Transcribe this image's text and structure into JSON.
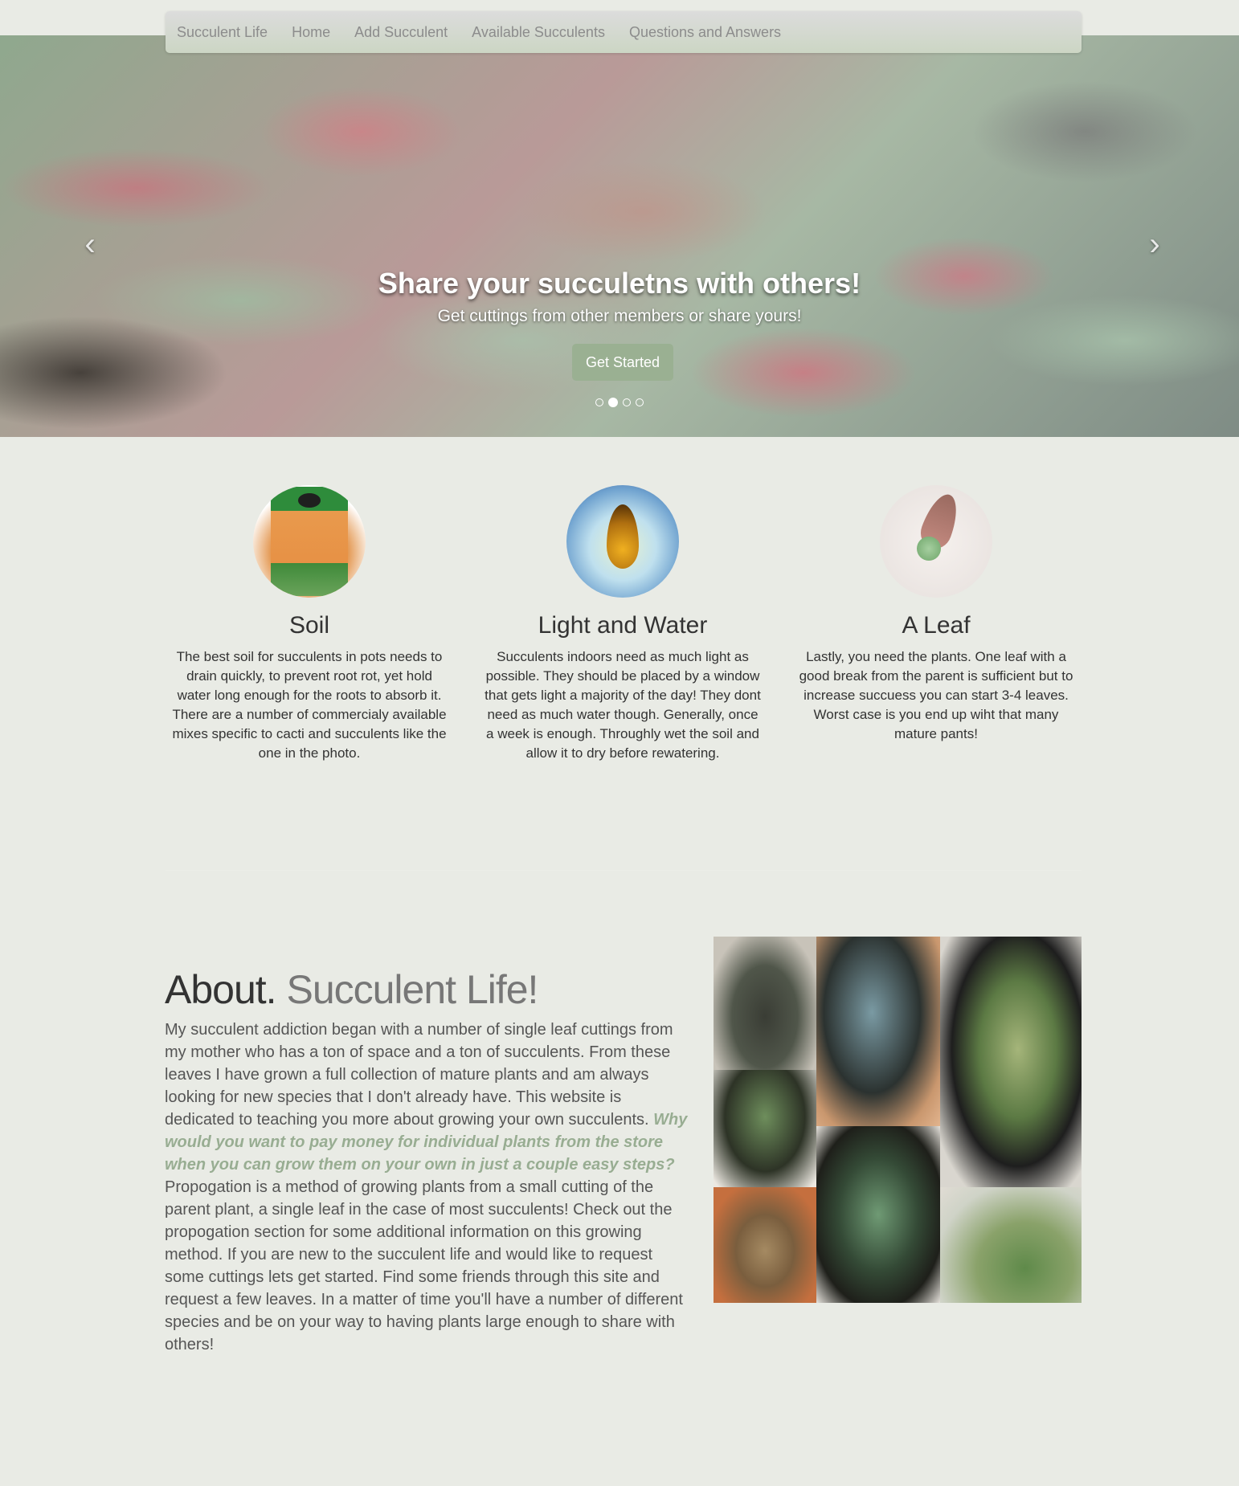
{
  "nav": {
    "brand": "Succulent Life",
    "items": [
      {
        "label": "Home"
      },
      {
        "label": "Add Succulent"
      },
      {
        "label": "Available Succulents"
      },
      {
        "label": "Questions and Answers"
      }
    ]
  },
  "carousel": {
    "title": "Share your succuletns with others!",
    "subtitle": "Get cuttings from other members or share yours!",
    "button": "Get Started",
    "prev_icon": "chevron-left-icon",
    "next_icon": "chevron-right-icon",
    "indicator_count": 4,
    "active_indicator": 2
  },
  "features": [
    {
      "title": "Soil",
      "text": "The best soil for succulents in pots needs to drain quickly, to prevent root rot, yet hold water long enough for the roots to absorb it. There are a number of commercialy available mixes specific to cacti and succulents like the one in the photo."
    },
    {
      "title": "Light and Water",
      "text": "Succulents indoors need as much light as possible. They should be placed by a window that gets light a majority of the day! They dont need as much water though. Generally, once a week is enough. Throughly wet the soil and allow it to dry before rewatering."
    },
    {
      "title": "A Leaf",
      "text": "Lastly, you need the plants. One leaf with a good break from the parent is sufficient but to increase succuess you can start 3-4 leaves. Worst case is you end up wiht that many mature pants!"
    }
  ],
  "about": {
    "heading": "About.",
    "heading_muted": "Succulent Life!",
    "text_before": "My succulent addiction began with a number of single leaf cuttings from my mother who has a ton of space and a ton of succulents. From these leaves I have grown a full collection of mature plants and am always looking for new species that I don't already have. This website is dedicated to teaching you more about growing your own succulents. ",
    "text_highlight": "Why would you want to pay money for individual plants from the store when you can grow them on your own in just a couple easy steps?",
    "text_after": " Propogation is a method of growing plants from a small cutting of the parent plant, a single leaf in the case of most succulents! Check out the propogation section for some additional information on this growing method. If you are new to the succulent life and would like to request some cuttings lets get started. Find some friends through this site and request a few leaves. In a matter of time you'll have a number of different species and be on your way to having plants large enough to share with others!"
  },
  "colors": {
    "background": "#e9ebe5",
    "accent": "#9ab092",
    "highlight_text": "#98ad92"
  }
}
